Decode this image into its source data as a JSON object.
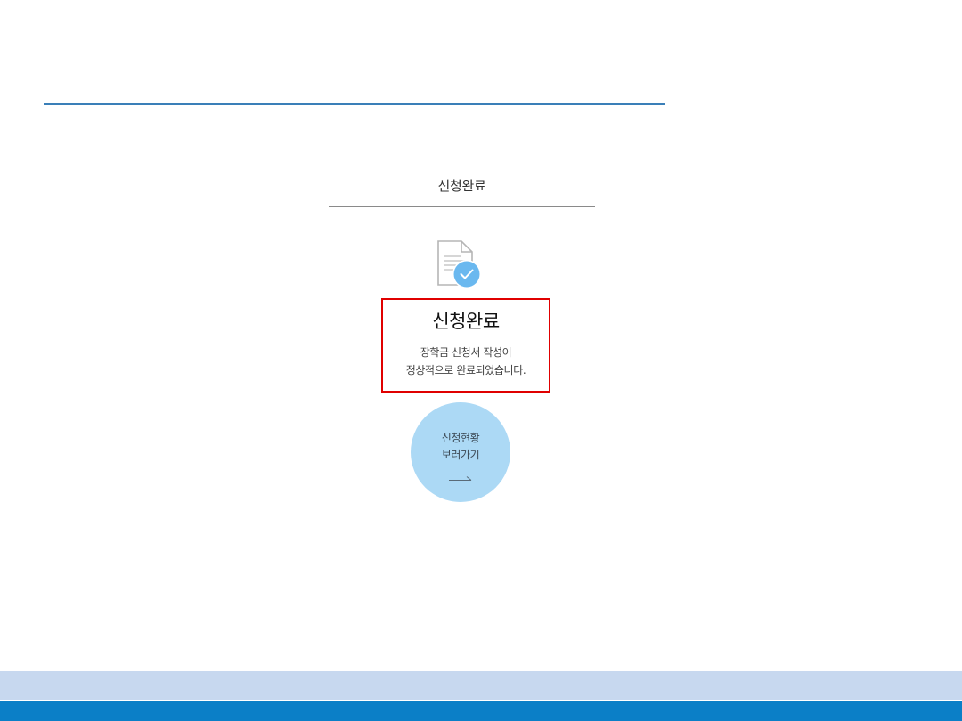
{
  "step": {
    "title": "신청완료"
  },
  "completion": {
    "title": "신청완료",
    "message_lines": [
      "장학금 신청서 작성이",
      "정상적으로 완료되었습니다."
    ]
  },
  "status_button": {
    "label_lines": [
      "신청현황",
      "보러가기"
    ],
    "icon": "arrow-right-icon"
  },
  "icons": {
    "document": "document-check-icon"
  },
  "colors": {
    "top_rule": "#3a7fb8",
    "highlight_border": "#e00000",
    "button_circle": "#acd9f5",
    "check_badge": "#6ab8ef",
    "footer_light": "#c7d8ef",
    "footer_dark": "#0b7fc7"
  }
}
